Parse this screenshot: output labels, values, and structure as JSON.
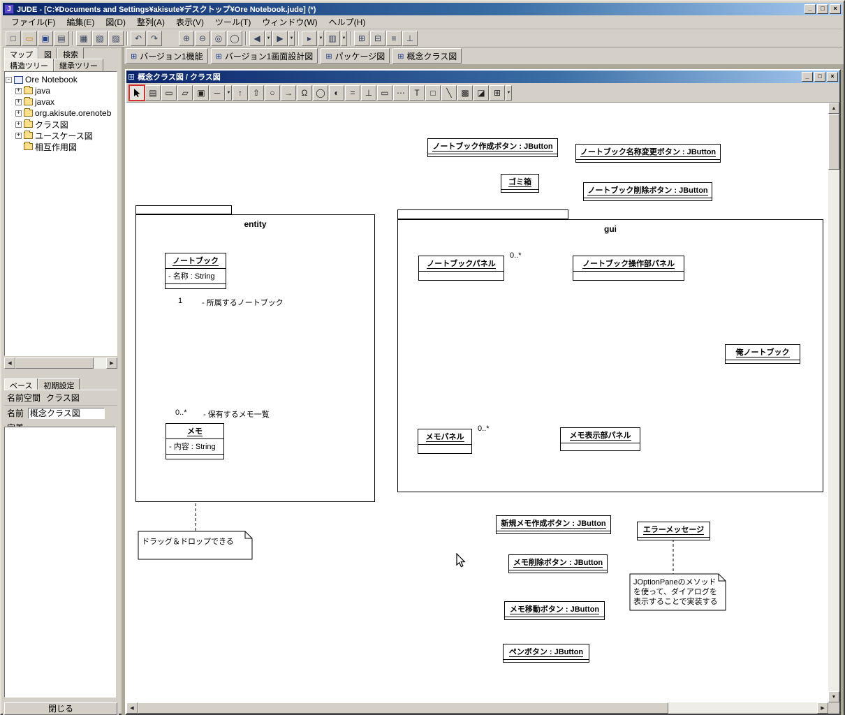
{
  "icons": {
    "dropdown": "▼",
    "plus": "+",
    "minus": "-",
    "up": "▲",
    "down": "▼",
    "left": "◀",
    "right": "▶",
    "diagram_tab": "⊞",
    "app_logo": "J"
  },
  "titlebar": {
    "title": "JUDE - [C:¥Documents and Settings¥akisute¥デスクトップ¥Ore Notebook.jude] (*)",
    "minimize": "_",
    "maximize": "□",
    "close": "×"
  },
  "menubar": {
    "items": [
      {
        "label": "ファイル(F)"
      },
      {
        "label": "編集(E)"
      },
      {
        "label": "図(D)"
      },
      {
        "label": "整列(A)"
      },
      {
        "label": "表示(V)"
      },
      {
        "label": "ツール(T)"
      },
      {
        "label": "ウィンドウ(W)"
      },
      {
        "label": "ヘルプ(H)"
      }
    ]
  },
  "main_toolbar": {
    "buttons": [
      {
        "name": "new-file",
        "glyph": "□"
      },
      {
        "name": "open",
        "glyph": "▭"
      },
      {
        "name": "save",
        "glyph": "▣"
      },
      {
        "name": "print",
        "glyph": "▤"
      },
      {
        "name": "copy",
        "glyph": "▦"
      },
      {
        "name": "paste",
        "glyph": "▧"
      },
      {
        "name": "duplicate",
        "glyph": "▨"
      },
      {
        "name": "undo",
        "glyph": "↶"
      },
      {
        "name": "redo",
        "glyph": "↷"
      },
      {
        "name": "zoom-in",
        "glyph": "⊕"
      },
      {
        "name": "zoom-out",
        "glyph": "⊖"
      },
      {
        "name": "zoom-reset",
        "glyph": "◎"
      },
      {
        "name": "zoom-fit",
        "glyph": "◯"
      },
      {
        "name": "nav-back",
        "glyph": "◀"
      },
      {
        "name": "nav-forward",
        "glyph": "▶"
      },
      {
        "name": "pointer-mode",
        "glyph": "▸"
      },
      {
        "name": "diagram-list",
        "glyph": "▥"
      },
      {
        "name": "structure-view",
        "glyph": "⊞"
      },
      {
        "name": "inherit-view",
        "glyph": "⊟"
      },
      {
        "name": "align-horizontal",
        "glyph": "≡"
      },
      {
        "name": "align-vertical",
        "glyph": "⊥"
      }
    ]
  },
  "left_panel": {
    "tabs_row1": [
      {
        "label": "マップ"
      },
      {
        "label": "図"
      },
      {
        "label": "検索"
      }
    ],
    "tabs_row2": [
      {
        "label": "構造ツリー"
      },
      {
        "label": "継承ツリー"
      }
    ],
    "tree": {
      "root": "Ore Notebook",
      "items": [
        {
          "label": "java"
        },
        {
          "label": "javax"
        },
        {
          "label": "org.akisute.orenoteb"
        },
        {
          "label": "クラス図"
        },
        {
          "label": "ユースケース図"
        },
        {
          "label": "相互作用図"
        }
      ]
    },
    "properties": {
      "tabs": [
        {
          "label": "ベース"
        },
        {
          "label": "初期設定"
        }
      ],
      "namespace_label": "名前空間",
      "namespace_value": "クラス図",
      "name_label": "名前",
      "name_value": "概念クラス図",
      "definition_label": "定義"
    },
    "close_button": "閉じる"
  },
  "mdi": {
    "tabs": [
      {
        "label": "バージョン1機能"
      },
      {
        "label": "バージョン1画面設計図"
      },
      {
        "label": "パッケージ図"
      },
      {
        "label": "概念クラス図"
      }
    ]
  },
  "inner_window": {
    "title": "概念クラス図 / クラス図",
    "minimize": "_",
    "restore": "□",
    "close": "×"
  },
  "inner_toolbar": {
    "buttons": [
      {
        "name": "select-tool",
        "glyph": ""
      },
      {
        "name": "list-tool",
        "glyph": "▤"
      },
      {
        "name": "class-tool",
        "glyph": "▭"
      },
      {
        "name": "package-tool",
        "glyph": "▱"
      },
      {
        "name": "model-tool",
        "glyph": "▣"
      },
      {
        "name": "association-tool",
        "glyph": "─"
      },
      {
        "name": "generalization-tool",
        "glyph": "↑"
      },
      {
        "name": "realization-tool",
        "glyph": "⇧"
      },
      {
        "name": "instance-tool",
        "glyph": "○"
      },
      {
        "name": "dependency-tool",
        "glyph": "→"
      },
      {
        "name": "actor-tool",
        "glyph": "Ω"
      },
      {
        "name": "usecase-tool",
        "glyph": "◯"
      },
      {
        "name": "state-tool",
        "glyph": "◐"
      },
      {
        "name": "qualifier-tool",
        "glyph": "="
      },
      {
        "name": "anchor-tool",
        "glyph": "⊥"
      },
      {
        "name": "frame-tool",
        "glyph": "▭"
      },
      {
        "name": "dashed-box-tool",
        "glyph": "⋯"
      },
      {
        "name": "text-tool",
        "glyph": "T"
      },
      {
        "name": "rect-tool",
        "glyph": "□"
      },
      {
        "name": "line-tool",
        "glyph": "╲"
      },
      {
        "name": "image-tool",
        "glyph": "▩"
      },
      {
        "name": "marker-tool",
        "glyph": "◪"
      },
      {
        "name": "grid-tool",
        "glyph": "⊞"
      }
    ]
  },
  "diagram": {
    "packages": [
      {
        "name": "entity"
      },
      {
        "name": "gui"
      }
    ],
    "classes": [
      {
        "name": "ノートブック作成ボタン : JButton"
      },
      {
        "name": "ノートブック名称変更ボタン : JButton"
      },
      {
        "name": "ゴミ箱"
      },
      {
        "name": "ノートブック削除ボタン : JButton"
      },
      {
        "name": "ノートブック",
        "attrs": [
          "- 名称 : String"
        ]
      },
      {
        "name": "メモ",
        "attrs": [
          "- 内容 : String"
        ]
      },
      {
        "name": "ノートブックパネル"
      },
      {
        "name": "ノートブック操作部パネル"
      },
      {
        "name": "俺ノートブック"
      },
      {
        "name": "メモパネル"
      },
      {
        "name": "メモ表示部パネル"
      },
      {
        "name": "新規メモ作成ボタン : JButton"
      },
      {
        "name": "エラーメッセージ"
      },
      {
        "name": "メモ削除ボタン : JButton"
      },
      {
        "name": "メモ移動ボタン : JButton"
      },
      {
        "name": "ペンボタン : JButton"
      }
    ],
    "edge_labels": [
      {
        "text": "1"
      },
      {
        "text": "- 所属するノートブック"
      },
      {
        "text": "0..*"
      },
      {
        "text": "- 保有するメモ一覧"
      },
      {
        "text": "0..*"
      },
      {
        "text": "0..*"
      }
    ],
    "notes": [
      {
        "text": "ドラッグ＆ドロップできる"
      },
      {
        "text": "JOptionPaneのメソッド\nを使って、ダイアログを\n表示することで実装する"
      }
    ]
  }
}
